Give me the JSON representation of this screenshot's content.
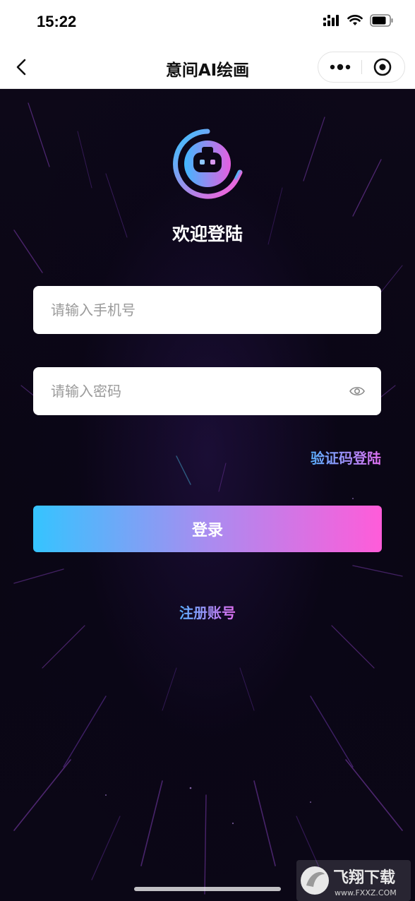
{
  "status_bar": {
    "time": "15:22"
  },
  "nav": {
    "title": "意间AI绘画"
  },
  "main": {
    "welcome": "欢迎登陆",
    "phone_placeholder": "请输入手机号",
    "password_placeholder": "请输入密码",
    "code_login_label": "验证码登陆",
    "login_button_label": "登录",
    "register_label": "注册账号"
  },
  "watermark": {
    "text": "飞翔下载",
    "url_text": "www.FXXZ.COM"
  },
  "icons": {
    "back": "chevron-left-icon",
    "more": "more-dots-icon",
    "close": "target-circle-icon",
    "eye": "eye-icon",
    "logo": "robot-logo-icon"
  },
  "colors": {
    "gradient_start": "#35c4ff",
    "gradient_end": "#ff5cd9",
    "background": "#0a0614"
  }
}
